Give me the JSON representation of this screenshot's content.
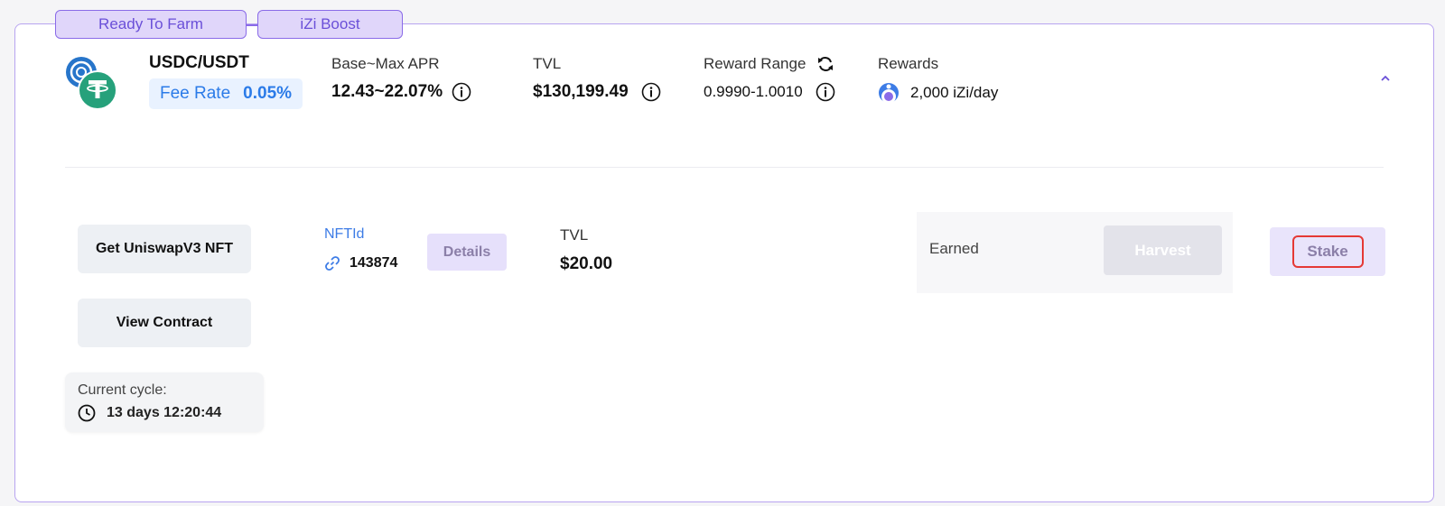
{
  "tags": {
    "ready": "Ready To Farm",
    "boost": "iZi Boost"
  },
  "pool": {
    "name": "USDC/USDT",
    "fee_label": "Fee Rate",
    "fee_value": "0.05%",
    "apr_label": "Base~Max APR",
    "apr_value": "12.43~22.07%",
    "tvl_label": "TVL",
    "tvl_value": "$130,199.49",
    "range_label": "Reward Range",
    "range_value": "0.9990-1.0010",
    "rewards_label": "Rewards",
    "rewards_value": "2,000 iZi/day"
  },
  "actions": {
    "get_nft": "Get UniswapV3 NFT",
    "view_contract": "View Contract"
  },
  "cycle": {
    "label": "Current cycle:",
    "value": "13 days 12:20:44"
  },
  "nft": {
    "label": "NFTId",
    "id": "143874",
    "details": "Details",
    "tvl_label": "TVL",
    "tvl_value": "$20.00"
  },
  "earned": {
    "label": "Earned",
    "harvest": "Harvest"
  },
  "stake": {
    "label": "Stake"
  },
  "colors": {
    "accent": "#8a6be8",
    "fee_blue": "#2b7be8",
    "stake_highlight": "#e53935",
    "usdt_green": "#26a17b"
  }
}
